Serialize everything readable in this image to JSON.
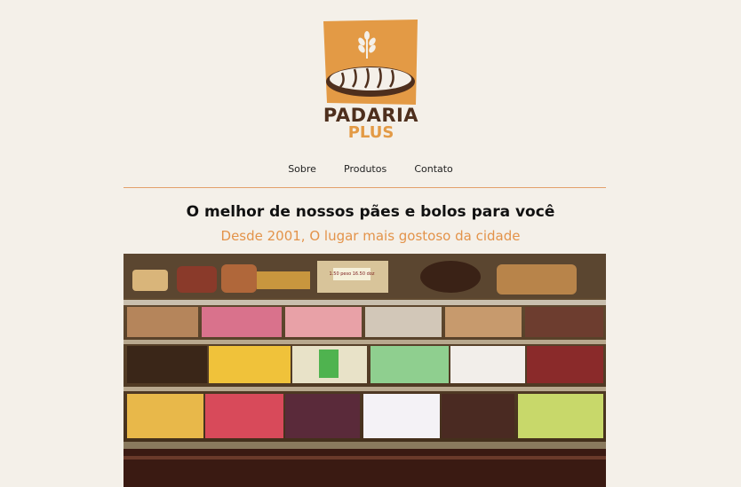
{
  "brand": {
    "line1": "PADARIA",
    "line2": "PLUS",
    "logo_icon": "bread-wheat-icon",
    "accent_color": "#e39a45",
    "dark_color": "#4e2f1d"
  },
  "nav": {
    "items": [
      {
        "label": "Sobre"
      },
      {
        "label": "Produtos"
      },
      {
        "label": "Contato"
      }
    ]
  },
  "main": {
    "title": "O melhor de nossos pães e bolos para você",
    "subtitle": "Desde 2001, O lugar mais gostoso da cidade"
  },
  "hero": {
    "description_icon": "pastry-display-case-image",
    "price_tag": "1.50 peso  16.50 doz"
  }
}
